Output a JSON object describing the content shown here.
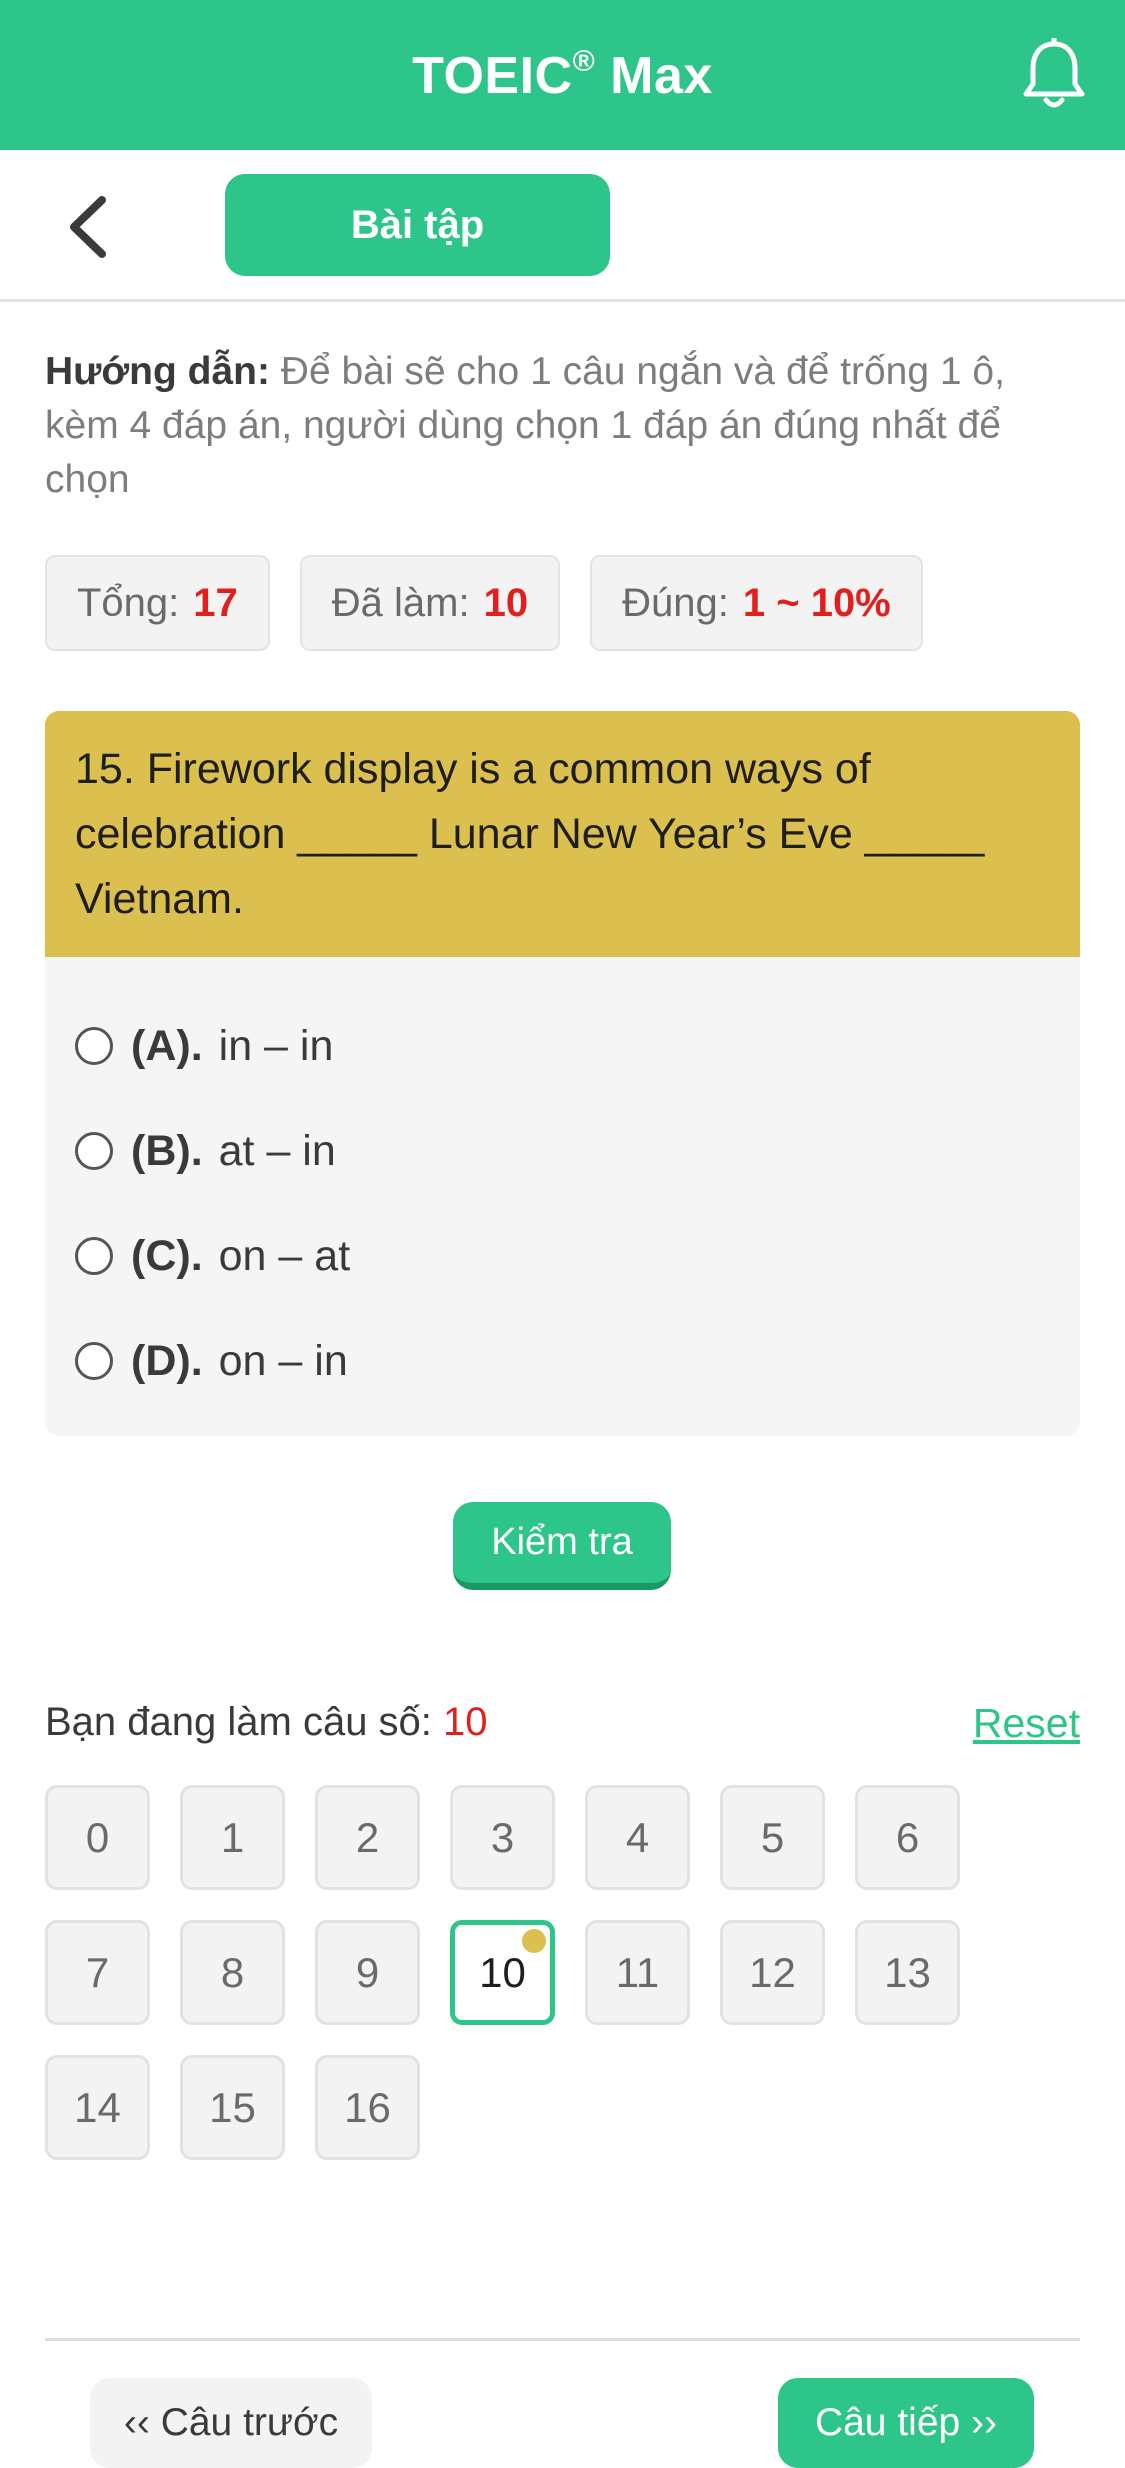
{
  "header": {
    "title": "TOEIC",
    "title_mark": "®",
    "title_suffix": " Max",
    "bell_icon": "bell-icon"
  },
  "subbar": {
    "back_icon": "chevron-left-icon",
    "tab_label": "Bài tập"
  },
  "guide": {
    "label": "Hướng dẫn:",
    "text": " Để bài sẽ cho 1 câu ngắn và để trống 1 ô, kèm 4 đáp án, người dùng chọn 1 đáp án đúng nhất để chọn"
  },
  "stats": [
    {
      "label": "Tổng:",
      "value": "17"
    },
    {
      "label": "Đã làm:",
      "value": "10"
    },
    {
      "label": "Đúng:",
      "value": "1 ~ 10%"
    }
  ],
  "question": {
    "text": "15. Firework display is a common ways of celebration _____ Lunar New Year’s Eve _____ Vietnam.",
    "options": [
      {
        "key": "(A).",
        "text": "in – in"
      },
      {
        "key": "(B).",
        "text": "at – in"
      },
      {
        "key": "(C).",
        "text": "on – at"
      },
      {
        "key": "(D).",
        "text": "on – in"
      }
    ]
  },
  "check_label": "Kiểm tra",
  "progress": {
    "label": "Bạn đang làm câu số:",
    "current": "10",
    "reset_label": "Reset"
  },
  "grid": {
    "numbers": [
      "0",
      "1",
      "2",
      "3",
      "4",
      "5",
      "6",
      "7",
      "8",
      "9",
      "10",
      "11",
      "12",
      "13",
      "14",
      "15",
      "16"
    ],
    "active": "10"
  },
  "footer": {
    "prev_label": "‹‹ Câu trước",
    "next_label": "Câu tiếp ››"
  },
  "colors": {
    "brand": "#2dc58a",
    "question_bg": "#dbbf4f",
    "highlight": "#e0201f"
  }
}
